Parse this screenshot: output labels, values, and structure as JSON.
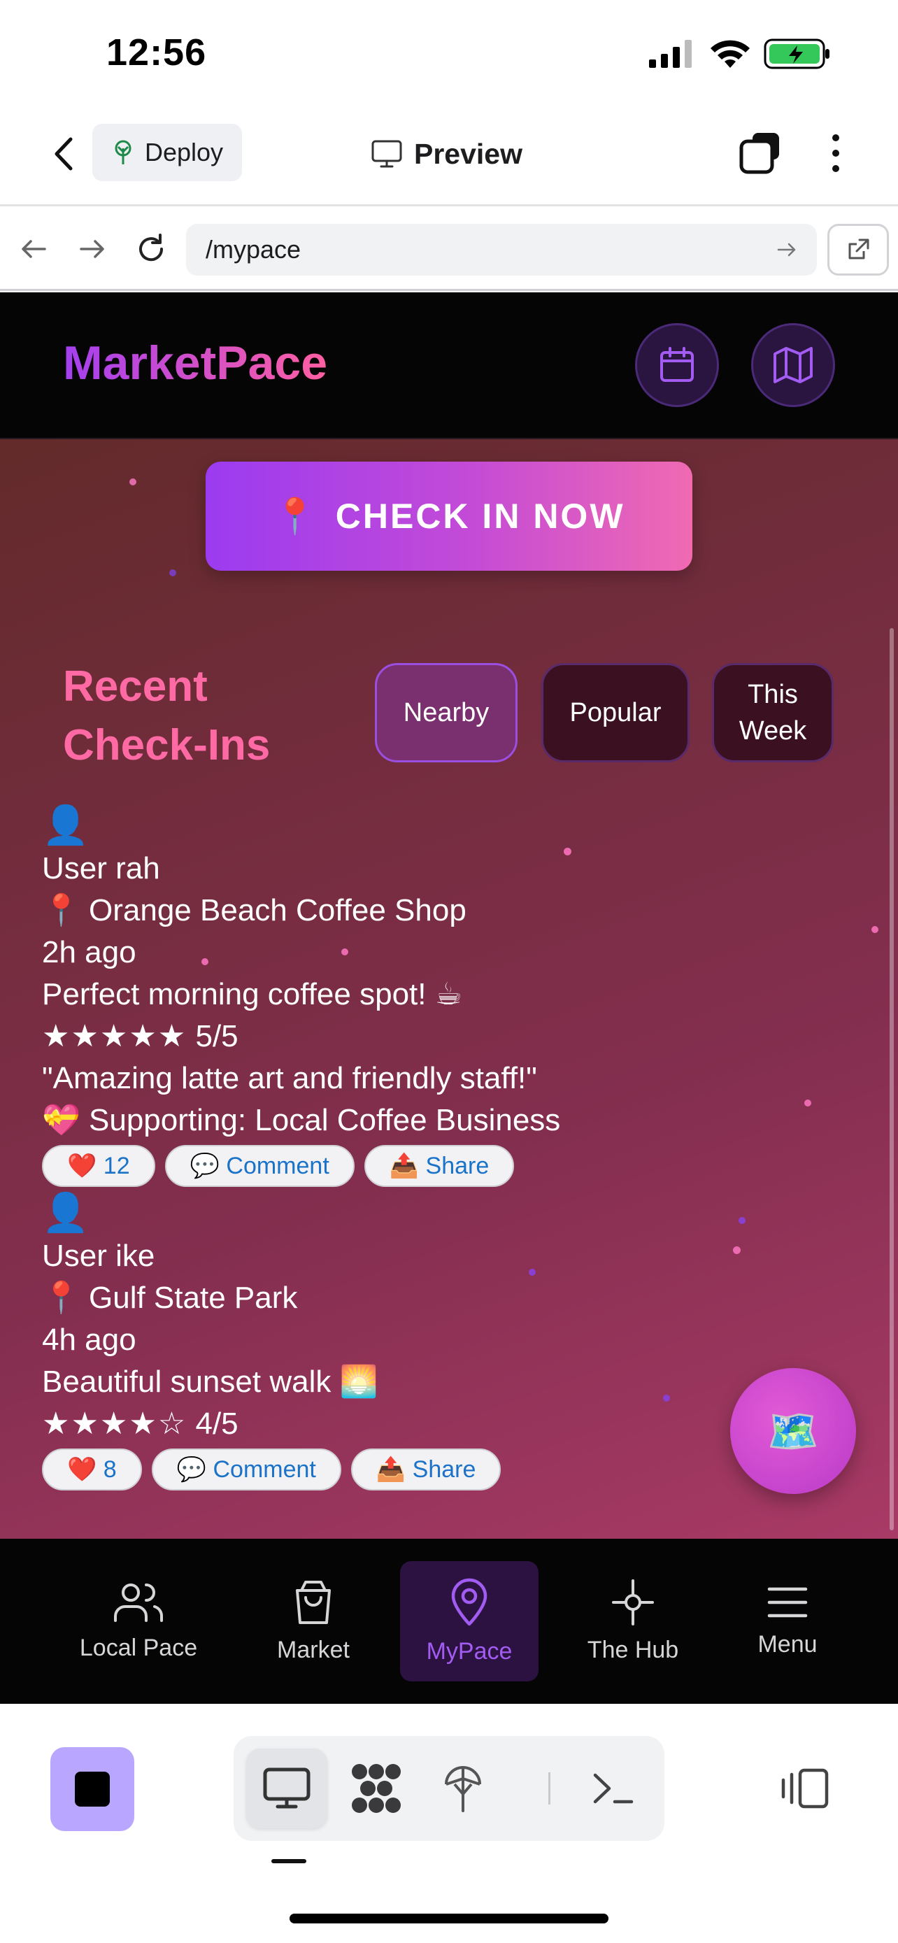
{
  "status_bar": {
    "time": "12:56"
  },
  "app_bar": {
    "deploy_label": "Deploy",
    "preview_label": "Preview"
  },
  "url_bar": {
    "url": "/mypace"
  },
  "site": {
    "brand": "MarketPace",
    "checkin_icon": "📍",
    "checkin_label": "CHECK IN NOW",
    "recent_title": "Recent Check-Ins",
    "filters": [
      {
        "label": "Nearby",
        "active": true
      },
      {
        "label": "Popular",
        "active": false
      },
      {
        "label": "This Week",
        "active": false
      }
    ],
    "checkins": [
      {
        "avatar": "👤",
        "user": "User rah",
        "place": "📍 Orange Beach Coffee Shop",
        "time": "2h ago",
        "note": "Perfect morning coffee spot! ☕",
        "rating_stars": "★★★★★",
        "rating_text": "5/5",
        "review": "\"Amazing latte art and friendly staff!\"",
        "supporting": "💝 Supporting: Local Coffee Business",
        "likes": "❤️ 12",
        "comment": "💬 Comment",
        "share": "📤 Share"
      },
      {
        "avatar": "👤",
        "user": "User ike",
        "place": "📍 Gulf State Park",
        "time": "4h ago",
        "note": "Beautiful sunset walk 🌅",
        "rating_stars": "★★★★☆",
        "rating_text": "4/5",
        "likes": "❤️ 8",
        "comment": "💬 Comment",
        "share": "📤 Share"
      }
    ],
    "fab_icon": "🗺️"
  },
  "bottom_nav": {
    "items": [
      {
        "label": "Local Pace",
        "icon": "users-icon"
      },
      {
        "label": "Market",
        "icon": "shopping-bag-icon"
      },
      {
        "label": "MyPace",
        "icon": "map-pin-icon",
        "active": true
      },
      {
        "label": "The Hub",
        "icon": "hub-icon"
      },
      {
        "label": "Menu",
        "icon": "menu-icon"
      }
    ]
  },
  "colors": {
    "brand_gradient_start": "#a43ff0",
    "brand_gradient_end": "#ff5fa2",
    "accent_purple": "#a35cf2",
    "link_blue": "#1a73c9",
    "stop_button": "#b9a7ff"
  }
}
